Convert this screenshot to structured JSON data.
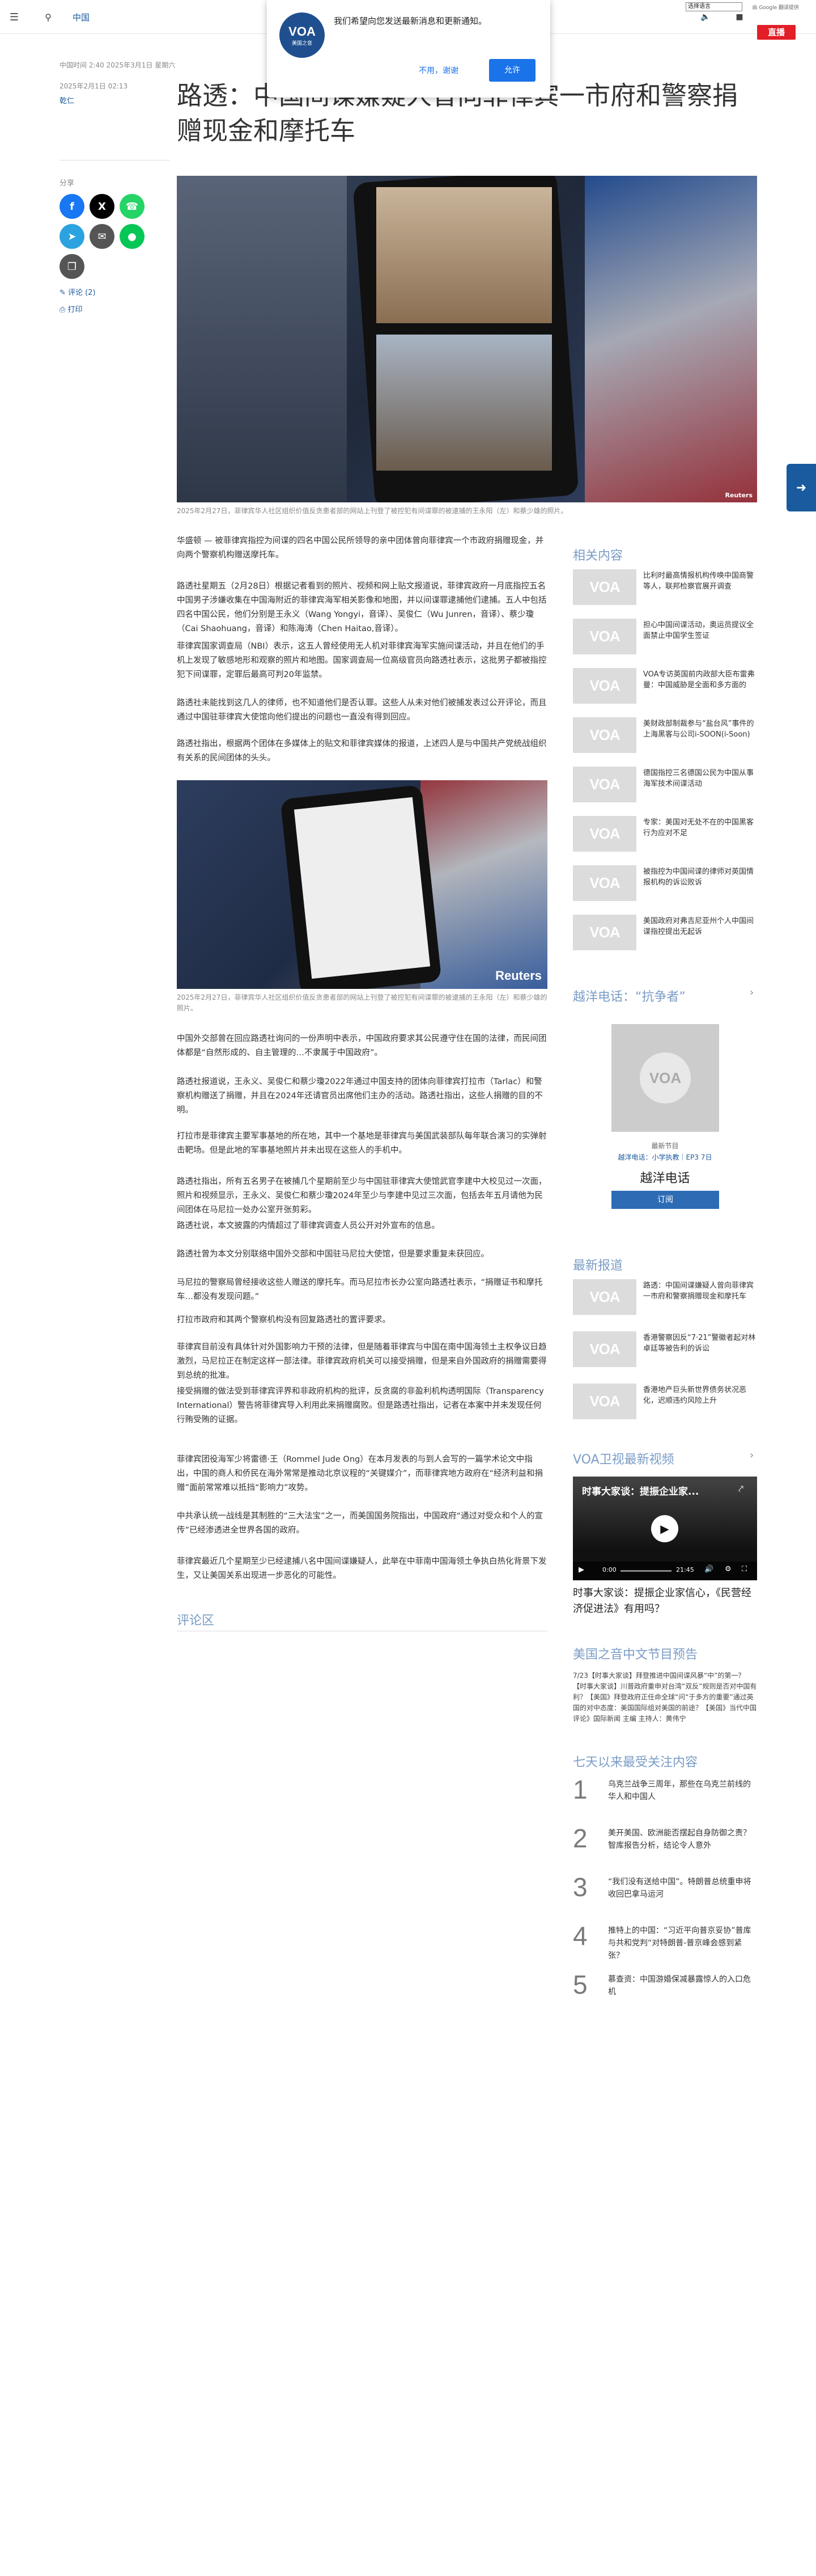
{
  "header": {
    "section": "中国",
    "lang_select": "选择语言",
    "google_translate": "由 Google 翻译提供",
    "live": "直播"
  },
  "notification": {
    "logo": "VOA",
    "logo_sub": "美国之音",
    "message": "我们希望向您发送最新消息和更新通知。",
    "deny": "不用，谢谢",
    "allow": "允许"
  },
  "article": {
    "meta_updated": "中国时间 2:40 2025年3月1日 星期六",
    "date": "2025年2月1日 02:13",
    "author": "乾仁",
    "title": "路透：中国间谍嫌疑人曾向菲律宾一市府和警察捐赠现金和摩托车",
    "image1_caption": "2025年2月27日，菲律宾华人社区组织价值反贪患者部的网站上刊登了被控犯有间谍罪的被逮捕的王永阳（左）和蔡少雄的照片。",
    "image2_caption": "2025年2月27日，菲律宾华人社区组织价值反贪患者部的网站上刊登了被控犯有间谍罪的被逮捕的王永阳（左）和蔡少雄的照片。",
    "image2_watermark": "Reuters",
    "image1_watermark": "Reuters",
    "paragraphs_a": [
      "华盛顿 — 被菲律宾指控为间谍的四名中国公民所领导的亲中团体曾向菲律宾一个市政府捐赠现金，并向两个警察机构赠送摩托车。",
      "路透社星期五（2月28日）根据记者看到的照片、视频和网上贴文报道说，菲律宾政府一月底指控五名中国男子涉嫌收集在中国海附近的菲律宾海军相关影像和地图，并以间谍罪逮捕他们逮捕。五人中包括四名中国公民，他们分别是王永义（Wang Yongyi，音译）、吴俊仁（Wu Junren，音译）、蔡少瓊（Cai Shaohuang，音译）和陈海涛（Chen Haitao,音译）。",
      "菲律宾国家调查局（NBI）表示，这五人曾经使用无人机对菲律宾海军实施间谍活动，并且在他们的手机上发现了敏感地形和观察的照片和地图。国家调查局一位高级官员向路透社表示，这批男子都被指控犯下间谍罪，定罪后最高可判20年监禁。",
      "路透社未能找到这几人的律师，也不知道他们是否认罪。这些人从未对他们被捕发表过公开评论，而且通过中国驻菲律宾大使馆向他们提出的问题也一直没有得到回应。",
      "路透社指出，根据两个团体在多媒体上的贴文和菲律宾媒体的报道，上述四人是与中国共产党统战组织有关系的民间团体的头头。"
    ],
    "paragraphs_b": [
      "中国外交部曾在回应路透社询问的一份声明中表示，中国政府要求其公民遵守住在国的法律，而民间团体都是“自然形成的、自主管理的…不隶属于中国政府”。",
      "路透社报道说，王永义、吴俊仁和蔡少瓊2022年通过中国支持的团体向菲律宾打拉市（Tarlac）和警察机构赠送了捐赠，并且在2024年还请官员出席他们主办的活动。路透社指出，这些人捐赠的目的不明。",
      "打拉市是菲律宾主要军事基地的所在地，其中一个基地是菲律宾与美国武装部队每年联合演习的实弹射击靶场。但是此地的军事基地照片并未出现在这些人的手机中。",
      "路透社指出，所有五名男子在被捕几个星期前至少与中国驻菲律宾大使馆武官李建中大校见过一次面，照片和视频显示，王永义、吴俊仁和蔡少瓊2024年至少与李建中见过三次面，包括去年五月请他为民间团体在马尼拉一处办公室开张剪彩。",
      "路透社说，本文披露的内情超过了菲律宾调查人员公开对外宣布的信息。",
      "路透社曾为本文分别联络中国外交部和中国驻马尼拉大使馆，但是要求重复未获回应。",
      "马尼拉的警察局曾经接收这些人赠送的摩托车。而马尼拉市长办公室向路透社表示，“捐赠证书和摩托车…都没有发现问题。”",
      "打拉市政府和其两个警察机构没有回复路透社的置评要求。",
      "菲律宾目前没有具体针对外国影响力干预的法律，但是随着菲律宾与中国在南中国海领土主权争议日趋激烈，马尼拉正在制定这样一部法律。菲律宾政府机关可以接受捐赠，但是来自外国政府的捐赠需要得到总统的批准。",
      "接受捐赠的做法受到菲律宾评界和非政府机构的批评，反贪腐的非盈利机构透明国际（Transparency International）警告将菲律宾导入利用此来捐赠腐败。但是路透社指出，记者在本案中并未发现任何行贿受贿的证据。",
      "菲律宾团役海军少将雷德·王（Rommel Jude Ong）在本月发表的与到人会写的一篇学术论文中指出，中国的商人和侨民在海外常常是推动北京议程的“关键媒介”，而菲律宾地方政府在“经济利益和捐赠”面前常常难以抵挡“影响力”攻势。",
      "中共承认统一战线是其制胜的“三大法宝”之一，而美国国务院指出，中国政府“通过对受众和个人的宣传”已经渗透进全世界各国的政府。",
      "菲律宾最近几个星期至少已经逮捕八名中国间谍嫌疑人，此举在中菲南中国海领土争执白热化背景下发生，又让美国关系出现进一步恶化的可能性。"
    ],
    "comments_heading": "评论区"
  },
  "share": {
    "label": "分享",
    "comments_link": "评论 (2)",
    "print_link": "打印"
  },
  "sidebar": {
    "related_title": "相关内容",
    "related": [
      "比利时最高情报机构传唤中国商警等人，联邦检察官展开调查",
      "担心中国间谍活动，奥运员提议全面禁止中国学生签证",
      "VOA专访英国前内政部大臣布雷弗曼：中国威胁是全面和多方面的",
      "美财政部制裁参与“盐台风”事件的上海黑客与公司i-SOON(i-Soon)",
      "德国指控三名德国公民为中国从事海军技术间谍活动",
      "专家：美国对无处不在的中国黑客行为应对不足",
      "被指控为中国间谍的律师对英国情报机构的诉讼败诉",
      "美国政府对弗吉尼亚州个人中国间谍指控提出无起诉"
    ],
    "phone_title": "越洋电话：“抗争者”",
    "phone_badge": "最新节目",
    "phone_meta": "越洋电话：小学执教｜EP3 7日",
    "phone_name": "越洋电话",
    "subscribe": "订阅",
    "latest_title": "最新报道",
    "latest": [
      "路透：中国间谍嫌疑人曾向菲律宾一市府和警察捐赠现金和摩托车",
      "香港警察因反“7·21”警徽者起对林卓廷等被告利的诉讼",
      "香港地产巨头新世界债务状况恶化，迟顺违约风险上升"
    ],
    "video_title": "VOA卫视最新视频",
    "video_overlay_title": "时事大家谈：提振企业家...",
    "video_time_start": "0:00",
    "video_time_end": "21:45",
    "video_caption": "时事大家谈：提振企业家信心，《民营经济促进法》有用吗？",
    "program_title": "美国之音中文节目预告",
    "program_text": "7/23【时事大家谈】拜登推进中国间谍风暴“中”的第一？【时事大家谈】川普政府重申对台湾“双反”规则是否对中国有利？【美国》拜登政府正任命全球“问“于多方的重要”通过英国的对中态度：美国国际组对美国的前途？【美国》当代中国评论》国际新闻 主编 主持人：黄伟宁",
    "popular_title": "七天以来最受关注内容",
    "popular": [
      "乌克兰战争三周年，那些在乌克兰前线的华人和中国人",
      "美开美国、欧洲能否摆起自身防御之责？智库报告分析，结论令人意外",
      "“我们没有送给中国”。特朗普总统重申将收回巴拿马运河",
      "推特上的中国：“习近平向普京妥协”普库与共和党判“对特朗普-普京峰会感到紧张？",
      "慕查资：中国游婚保减暴露惊人的入口危机"
    ]
  }
}
